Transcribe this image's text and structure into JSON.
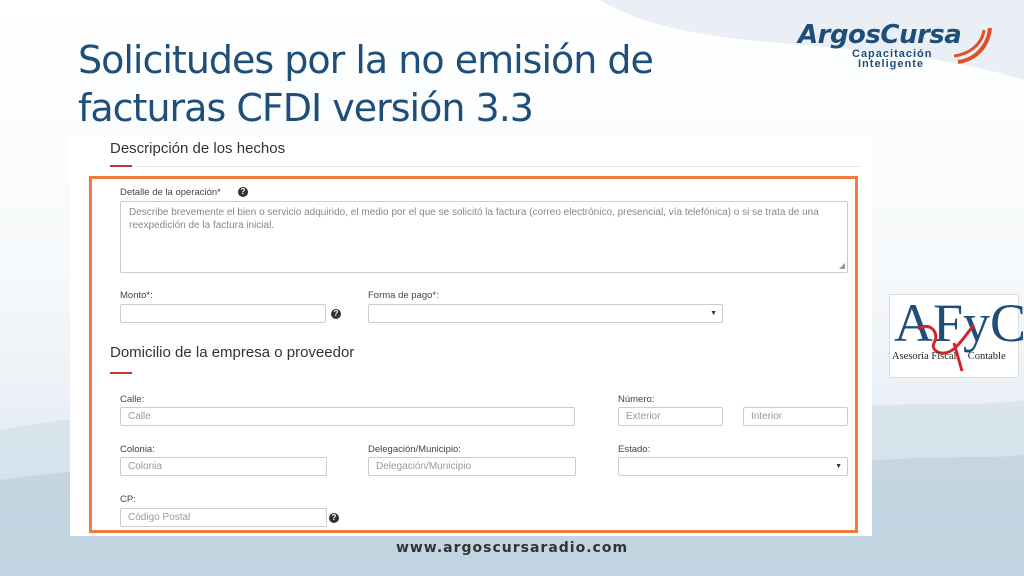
{
  "slide": {
    "title_line1": "Solicitudes por la no emisión de",
    "title_line2": "facturas CFDI versión 3.3",
    "footer": "www.argoscursaradio.com"
  },
  "logos": {
    "argos_brand": "ArgosCursa",
    "argos_tag1": "Capacitación",
    "argos_tag2": "Inteligente",
    "afyc_letters": "AFyC",
    "afyc_caption_left": "Asesoría Fiscal",
    "afyc_caption_right": "Contable"
  },
  "form": {
    "section_hechos": "Descripción de los hechos",
    "detalle_label": "Detalle de la operación*",
    "detalle_placeholder": "Describe brevemente el bien o servicio adquirido, el medio por el que se solicitó la factura (correo electrónico, presencial, vía telefónica) o si se trata de una reexpedición de la factura inicial.",
    "monto_label": "Monto*:",
    "forma_pago_label": "Forma de pago*:",
    "section_domicilio": "Domicilio de la empresa o proveedor",
    "calle_label": "Calle:",
    "calle_placeholder": "Calle",
    "numero_label": "Número:",
    "exterior_placeholder": "Exterior",
    "interior_placeholder": "Interior",
    "colonia_label": "Colonia:",
    "colonia_placeholder": "Colonia",
    "delegacion_label": "Delegación/Municipio:",
    "delegacion_placeholder": "Delegación/Municipio",
    "estado_label": "Estado:",
    "cp_label": "CP:",
    "cp_placeholder": "Código Postal"
  },
  "colors": {
    "title": "#1f4e79",
    "highlight_frame": "#f07b3a",
    "accent": "#c0392b"
  }
}
